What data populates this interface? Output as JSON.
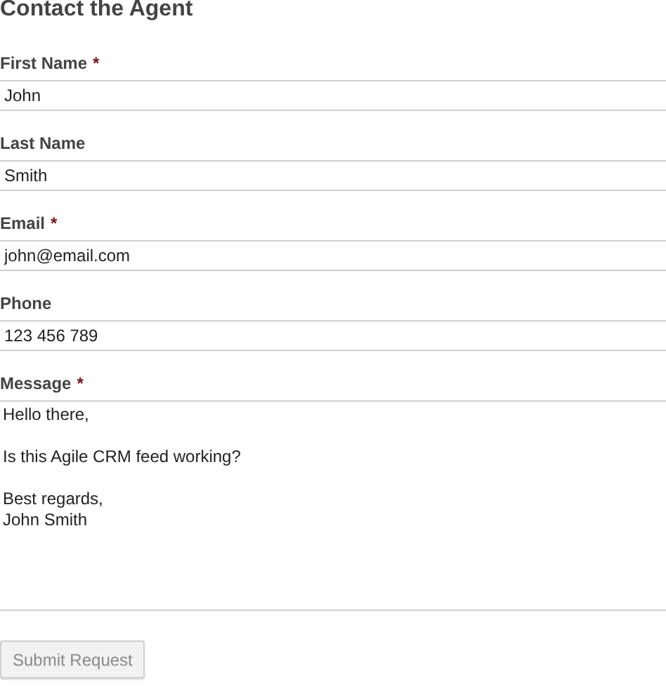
{
  "title": "Contact the Agent",
  "fields": [
    {
      "label": "First Name",
      "mark": "*",
      "kind": "input",
      "value": "John"
    },
    {
      "label": "Last Name",
      "kind": "input",
      "value": "Smith"
    },
    {
      "label": "Email",
      "mark": "*",
      "kind": "input",
      "value": "john@email.com"
    },
    {
      "label": "Phone",
      "kind": "input",
      "value": "123 456 789"
    },
    {
      "label": "Message",
      "mark": "*",
      "kind": "textarea",
      "value": "Hello there,\n\nIs this Agile CRM feed working?\n\nBest regards,\nJohn Smith"
    }
  ],
  "submit": {
    "label": "Submit Request",
    "disabled": true
  }
}
